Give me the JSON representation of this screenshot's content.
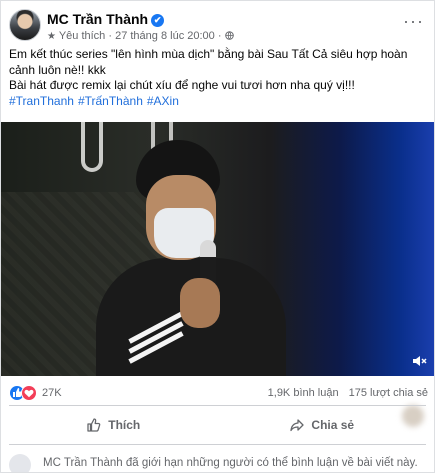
{
  "post": {
    "author": "MC Trần Thành",
    "verified_icon": "✔",
    "meta_star": "★",
    "meta_text": "Yêu thích · 27 tháng 8 lúc 20:00 ·",
    "more_label": "···",
    "text_line1": "Em kết thúc series \"lên hình mùa dịch\" bằng bài Sau Tất Cả siêu hợp hoàn cảnh luôn nè!! kkk",
    "text_line2": "Bài hát được remix lại chút xíu để nghe vui tươi hơn nha quý vị!!!",
    "hashtags": [
      "#TranThanh",
      "#TrấnThành",
      "#AXin"
    ]
  },
  "video": {
    "volume_icon": "speaker-icon"
  },
  "engagement": {
    "reaction_count": "27K",
    "comments": "1,9K bình luận",
    "shares": "175 lượt chia sẻ"
  },
  "actions": {
    "like_label": "Thích",
    "share_label": "Chia sẻ"
  },
  "notice": {
    "text": "MC Trần Thành đã giới hạn những người có thể bình luận về bài viết này."
  },
  "colors": {
    "accent": "#1877f2",
    "hashtag": "#216fdb",
    "love": "#f33e58",
    "muted": "#65676b"
  }
}
